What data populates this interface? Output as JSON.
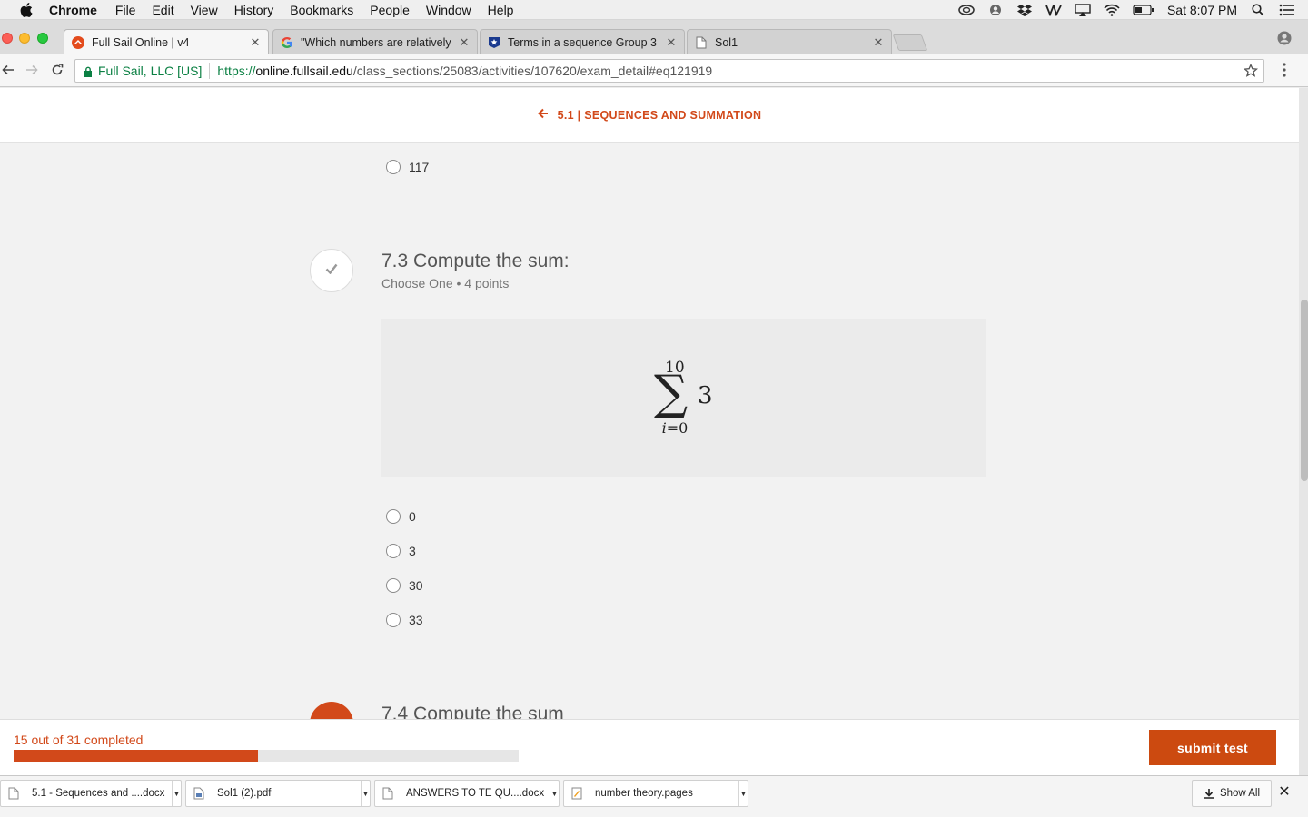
{
  "menubar": {
    "app": "Chrome",
    "items": [
      "File",
      "Edit",
      "View",
      "History",
      "Bookmarks",
      "People",
      "Window",
      "Help"
    ],
    "clock": "Sat 8:07 PM",
    "status_icons": [
      "creative-cloud-icon",
      "user-sync-icon",
      "dropbox-icon",
      "vectorworks-icon",
      "airplay-icon",
      "wifi-icon",
      "battery-icon",
      "spotlight-icon",
      "notification-center-icon"
    ]
  },
  "tabs": [
    {
      "title": "Full Sail Online | v4",
      "favicon": "fullsail-icon",
      "active": true
    },
    {
      "title": "\"Which numbers are relatively",
      "favicon": "google-icon",
      "active": false
    },
    {
      "title": "Terms in a sequence Group 3",
      "favicon": "star-badge-icon",
      "active": false
    },
    {
      "title": "Sol1",
      "favicon": "document-icon",
      "active": false
    }
  ],
  "omnibox": {
    "secure_label": "Full Sail, LLC [US]",
    "url_scheme": "https://",
    "url_host": "online.fullsail.edu",
    "url_path": "/class_sections/25083/activities/107620/exam_detail#eq121919"
  },
  "page": {
    "breadcrumb": "5.1 | SEQUENCES AND SUMMATION",
    "prev_question_option": "117",
    "question": {
      "title": "7.3 Compute the sum:",
      "meta": "Choose One • 4 points",
      "formula": {
        "upper": "10",
        "variable": "i",
        "lower_rest": "=0",
        "term": "3"
      },
      "options": [
        "0",
        "3",
        "30",
        "33"
      ]
    },
    "next_question_title": "7.4 Compute the sum"
  },
  "footer": {
    "progress_text": "15 out of 31 completed",
    "completed": 15,
    "total": 31,
    "submit_label": "submit test"
  },
  "downloads": {
    "items": [
      {
        "name": "5.1 - Sequences and ....docx",
        "icon": "document-icon"
      },
      {
        "name": "Sol1 (2).pdf",
        "icon": "pdf-icon"
      },
      {
        "name": "ANSWERS TO TE QU....docx",
        "icon": "document-icon"
      },
      {
        "name": "number theory.pages",
        "icon": "pages-icon"
      }
    ],
    "show_all_label": "Show All"
  },
  "colors": {
    "accent": "#d2491a",
    "submit": "#cc4a10",
    "secure": "#0b8043"
  }
}
